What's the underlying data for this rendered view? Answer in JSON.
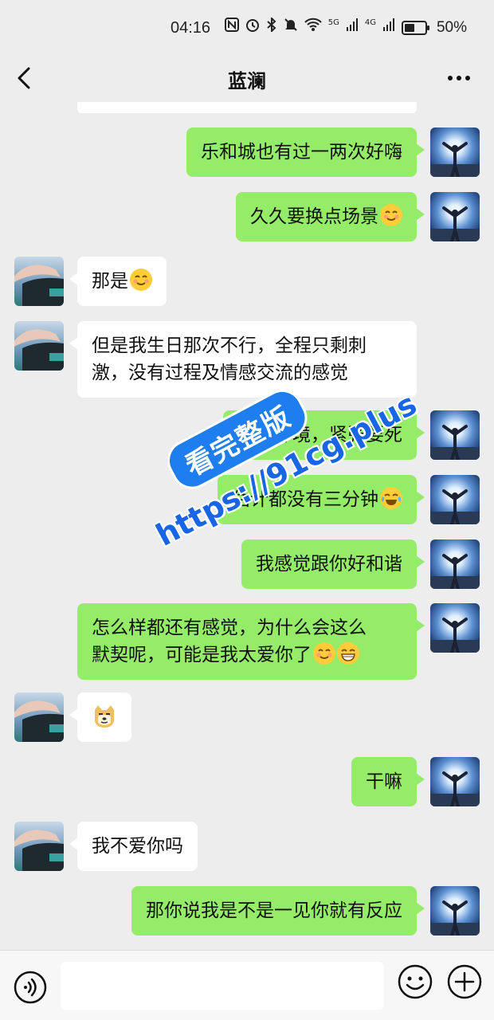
{
  "status": {
    "time": "04:16",
    "icons": [
      "nfc-icon",
      "alarm-icon",
      "bluetooth-icon",
      "mute-icon",
      "wifi-icon",
      "signal-5g-icon",
      "signal-4g-icon",
      "battery-icon"
    ],
    "net1": "5G",
    "net2": "4G",
    "battery_pct": "50%"
  },
  "header": {
    "title": "蓝澜",
    "back_icon": "chevron-left-icon",
    "more_icon": "more-dots-icon"
  },
  "messages": [
    {
      "from": "me",
      "text": "乐和城也有过一两次好嗨"
    },
    {
      "from": "me",
      "text": "久久要换点场景",
      "emoji": "blush"
    },
    {
      "from": "her",
      "text": "那是",
      "emoji": "blush"
    },
    {
      "from": "her",
      "text": "但是我生日那次不行，全程只剩刺",
      "text2": "激，没有过程及情感交流的感觉"
    },
    {
      "from": "me",
      "text": "那种环境，紧张要死"
    },
    {
      "from": "me",
      "text": "估计都没有三分钟",
      "emoji": "tears-of-joy"
    },
    {
      "from": "me",
      "text": "我感觉跟你好和谐"
    },
    {
      "from": "me",
      "text": "怎么样都还有感觉，为什么会这么",
      "text2": "默契呢，可能是我太爱你了",
      "emoji": "blush",
      "emoji2": "laugh"
    },
    {
      "from": "her",
      "sticker": "doge-emoji"
    },
    {
      "from": "me",
      "text": "干嘛"
    },
    {
      "from": "her",
      "text": "我不爱你吗"
    },
    {
      "from": "me",
      "text": "那你说我是不是一见你就有反应"
    }
  ],
  "watermark": {
    "badge": "看完整版",
    "url": "https://91cg.plus"
  },
  "input_bar": {
    "voice_icon": "voice-icon",
    "placeholder": "",
    "emoji_icon": "smiley-icon",
    "plus_icon": "plus-icon"
  },
  "colors": {
    "background": "#ededed",
    "my_bubble": "#95ec69",
    "her_bubble": "#ffffff",
    "watermark_blue": "#1e7ef0"
  }
}
